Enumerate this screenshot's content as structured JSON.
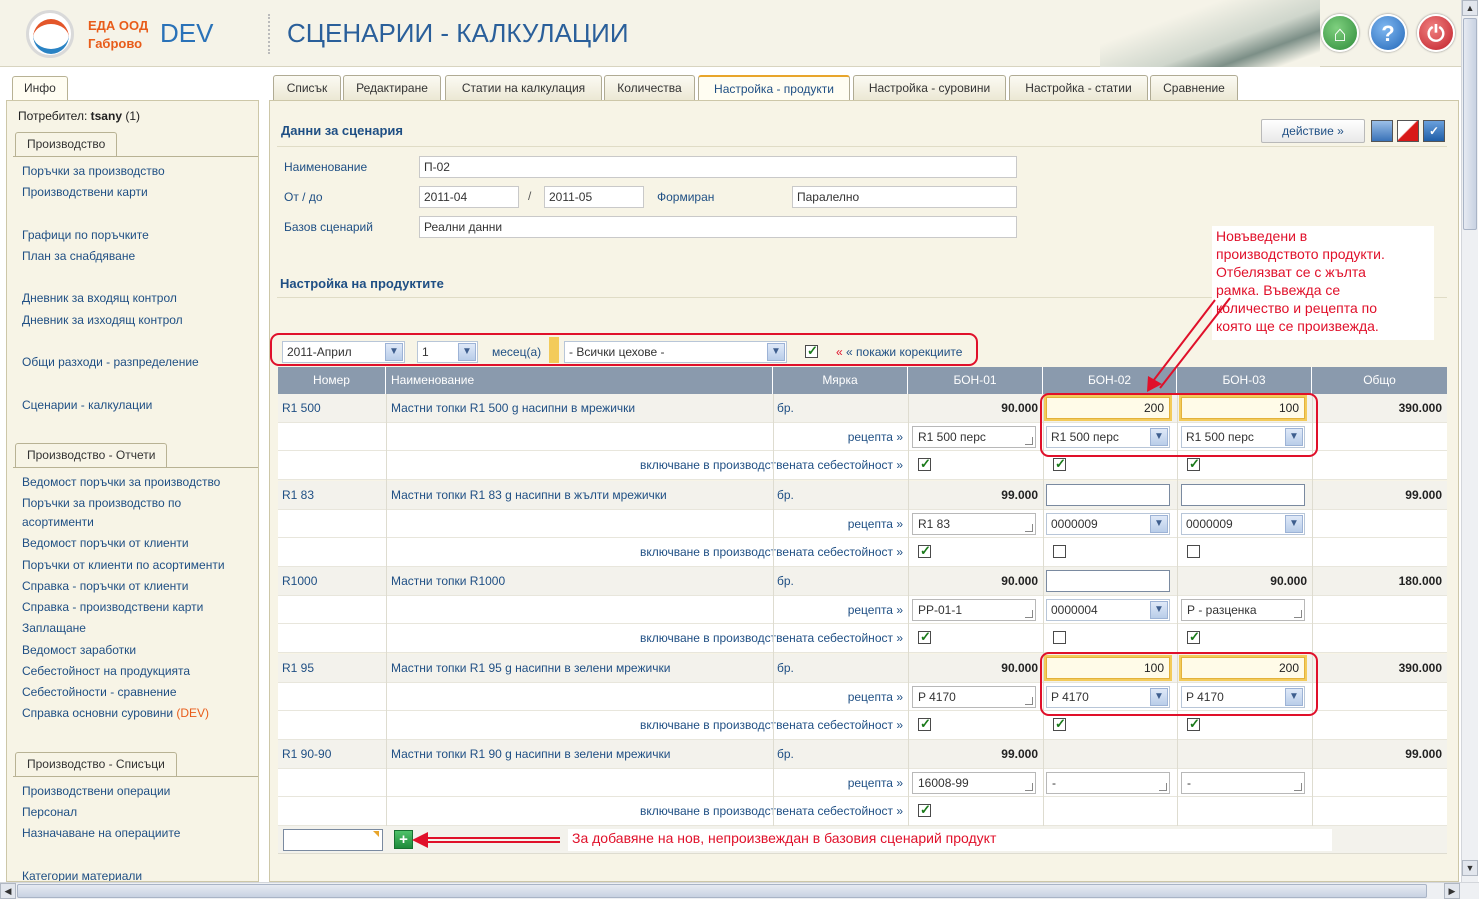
{
  "header": {
    "company_line1": "ЕДА ООД",
    "company_line2": "Габрово",
    "env": "DEV",
    "title": "СЦЕНАРИИ - КАЛКУЛАЦИИ"
  },
  "sidebar": {
    "info_tab": "Инфо",
    "user_label": "Потребител:",
    "user_name": "tsany",
    "user_count": "(1)",
    "sec1": "Производство",
    "sec1_items": [
      "Поръчки за производство",
      "Производствени карти",
      "Графици по поръчките",
      "План за снабдяване",
      "Дневник за входящ контрол",
      "Дневник за изходящ контрол",
      "Общи разходи - разпределение",
      "Сценарии - калкулации"
    ],
    "sec2": "Производство - Отчети",
    "sec2_items": [
      "Ведомост поръчки за производство",
      "Поръчки за производство по",
      "асортименти",
      "Ведомост поръчки от клиенти",
      "Поръчки от клиенти по асортименти",
      "Справка - поръчки от клиенти",
      "Справка - производствени карти",
      "Заплащане",
      "Ведомост заработки",
      "Себестойност на продукцията",
      "Себестойности - сравнение",
      "Справка основни суровини"
    ],
    "sec2_dev": "(DEV)",
    "sec3": "Производство - Списъци",
    "sec3_items": [
      "Производствени операции",
      "Персонал",
      "Назначаване на операциите",
      "Категории материали"
    ]
  },
  "tabs": [
    "Списък",
    "Редактиране",
    "Статии на калкулация",
    "Количества",
    "Настройка - продукти",
    "Настройка - суровини",
    "Настройка - статии",
    "Сравнение"
  ],
  "scenario": {
    "heading": "Данни за сценария",
    "action": "действие »",
    "name_label": "Наименование",
    "name_value": "П-02",
    "period_label": "От / до",
    "from": "2011-04",
    "sep": "/",
    "to": "2011-05",
    "formed_label": "Формиран",
    "formed_value": "Паралелно",
    "base_label": "Базов сценарий",
    "base_value": "Реални данни"
  },
  "products": {
    "heading": "Настройка на продуктите",
    "filter_month": "2011-Април",
    "filter_count": "1",
    "filter_unit": "месец(а)",
    "filter_shop": "- Всички цехове -",
    "show_corr": "« покажи корекциите",
    "columns": [
      "Номер",
      "Наименование",
      "Мярка",
      "БОН-01",
      "БОН-02",
      "БОН-03",
      "Общо"
    ],
    "recipe_label": "рецепта »",
    "include_label": "включване в производствената себестойност »",
    "rows": [
      {
        "code": "R1 500",
        "name": "Мастни топки R1 500 g насипни в мрежички",
        "unit": "бр.",
        "b1": "90.000",
        "b2": "200",
        "b3": "100",
        "total": "390.000",
        "r1": "R1 500 перс",
        "r2": "R1 500 перс",
        "r3": "R1 500 перс"
      },
      {
        "code": "R1 83",
        "name": "Мастни топки R1 83 g насипни в жълти мрежички",
        "unit": "бр.",
        "b1": "99.000",
        "b2": "",
        "b3": "",
        "total": "99.000",
        "r1": "R1 83",
        "r2": "0000009",
        "r3": "0000009"
      },
      {
        "code": "R1000",
        "name": "Мастни топки R1000",
        "unit": "бр.",
        "b1": "90.000",
        "b2": "",
        "b3": "90.000",
        "total": "180.000",
        "r1": "PP-01-1",
        "r2": "0000004",
        "r3": "Р - разценка"
      },
      {
        "code": "R1 95",
        "name": "Мастни топки R1 95 g насипни в зелени мрежички",
        "unit": "бр.",
        "b1": "90.000",
        "b2": "100",
        "b3": "200",
        "total": "390.000",
        "r1": "P 4170",
        "r2": "P 4170",
        "r3": "P 4170"
      },
      {
        "code": "R1 90-90",
        "name": "Мастни топки R1 90 g насипни в зелени мрежички",
        "unit": "бр.",
        "b1": "99.000",
        "b2": "",
        "b3": "",
        "total": "99.000",
        "r1": "16008-99",
        "r2": "-",
        "r3": "-"
      }
    ]
  },
  "notes": {
    "new_products": [
      "Новъведени в",
      "производството продукти.",
      "Отбелязват се с жълта",
      "рамка. Въвежда се",
      "количество и рецепта по",
      "която ще се произвежда."
    ],
    "add_new": "За добавяне на нов, непроизвеждан в базовия сценарий продукт"
  },
  "colors": {
    "accent": "#1f4f84",
    "highlight": "#e0102a",
    "header_bg": "#8a9aad"
  }
}
